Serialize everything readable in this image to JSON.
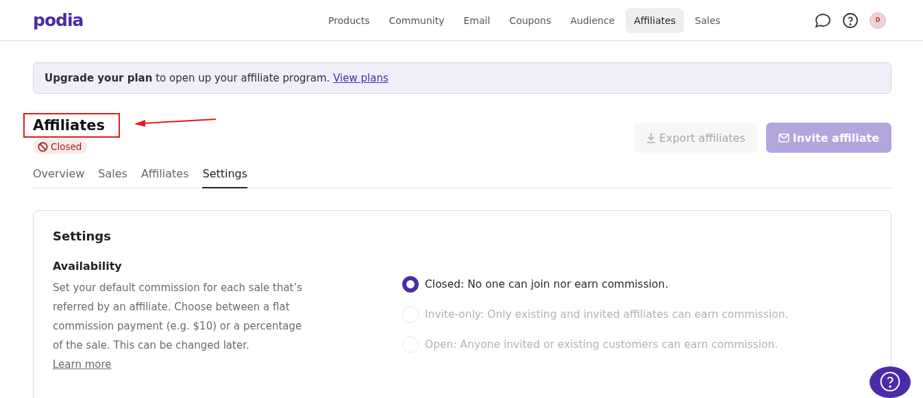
{
  "header": {
    "logo": "podia",
    "nav": [
      {
        "label": "Products",
        "selected": false
      },
      {
        "label": "Community",
        "selected": false
      },
      {
        "label": "Email",
        "selected": false
      },
      {
        "label": "Coupons",
        "selected": false
      },
      {
        "label": "Audience",
        "selected": false
      },
      {
        "label": "Affiliates",
        "selected": true
      },
      {
        "label": "Sales",
        "selected": false
      }
    ],
    "avatar": "D"
  },
  "banner": {
    "bold": "Upgrade your plan",
    "text": " to open up your affiliate program. ",
    "link": "View plans"
  },
  "page": {
    "title": "Affiliates",
    "status": "Closed",
    "buttons": [
      {
        "label": "Export affiliates",
        "kind": "secondary",
        "disabled": true
      },
      {
        "label": "Invite affiliate",
        "kind": "primary",
        "disabled": true
      }
    ]
  },
  "tabs": [
    {
      "label": "Overview",
      "selected": false
    },
    {
      "label": "Sales",
      "selected": false
    },
    {
      "label": "Affiliates",
      "selected": false
    },
    {
      "label": "Settings",
      "selected": true
    }
  ],
  "settings": {
    "title": "Settings",
    "section": "Availability",
    "description": "Set your default commission for each sale that’s referred by an affiliate. Choose between a flat commission payment (e.g. $10) or a percentage of the sale. This can be changed later. ",
    "link": "Learn more",
    "options": [
      {
        "label": "Closed:",
        "description": " No one can join nor earn commission.",
        "selected": true,
        "disabled": false
      },
      {
        "label": "Invite-only:",
        "description": " Only existing and invited affiliates can earn commission.",
        "selected": false,
        "disabled": true
      },
      {
        "label": "Open:",
        "description": " Anyone invited or existing customers can earn commission.",
        "selected": false,
        "disabled": true
      }
    ]
  }
}
